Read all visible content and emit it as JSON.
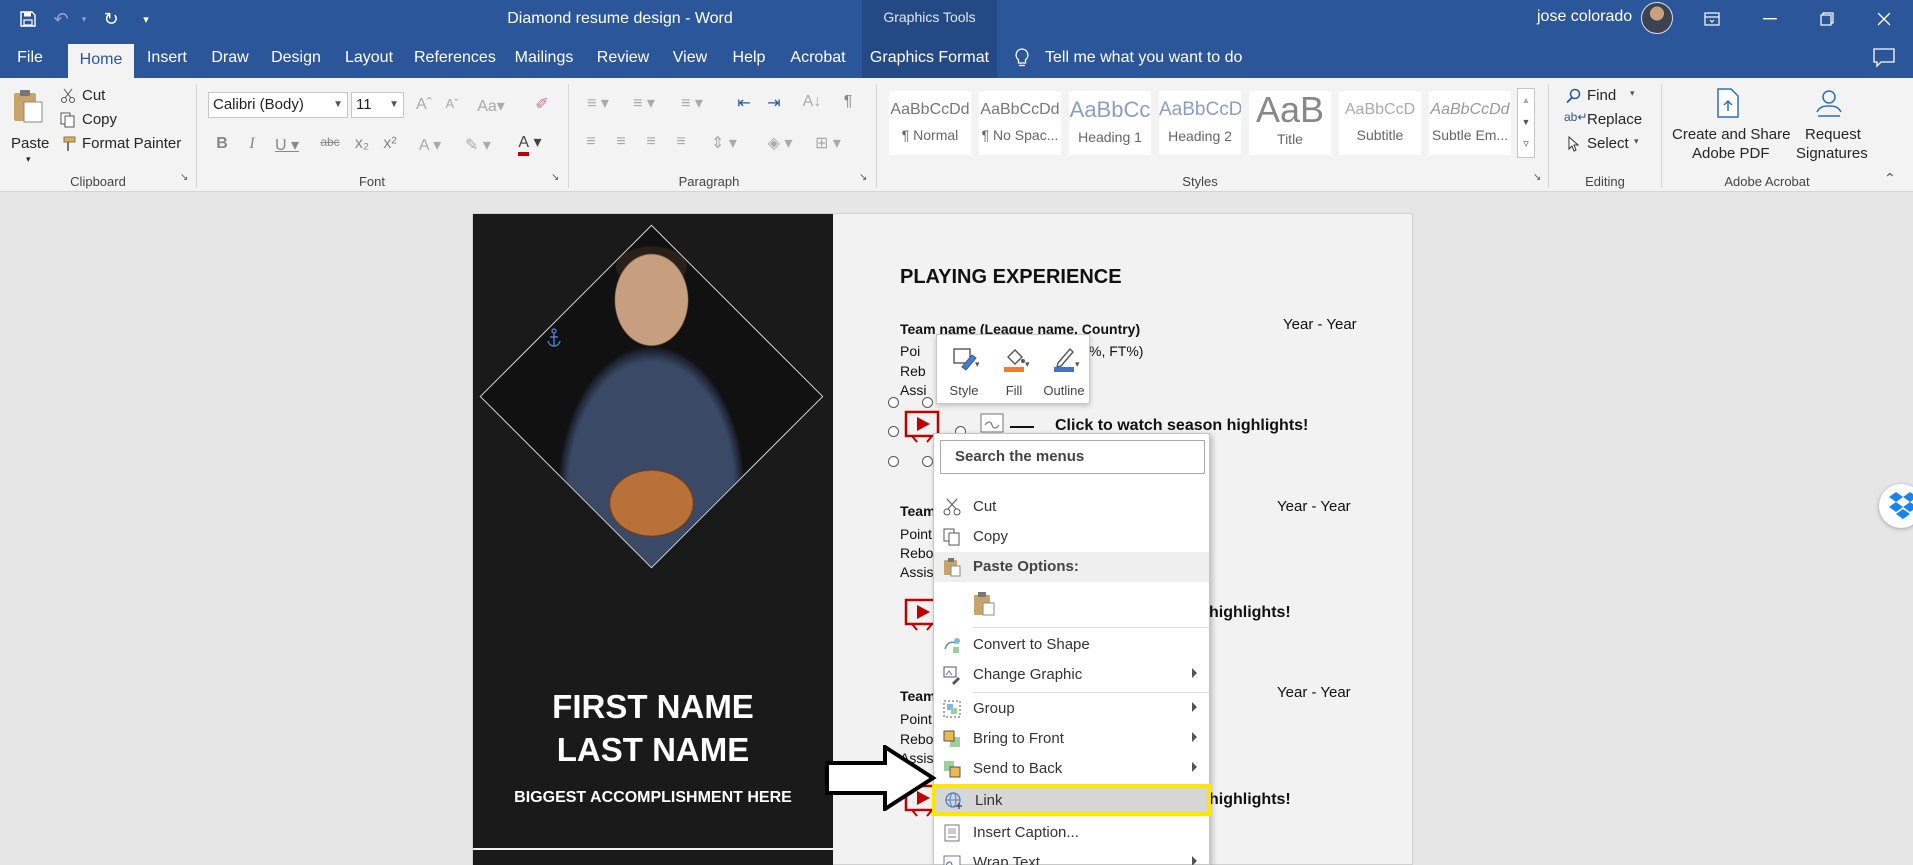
{
  "window": {
    "title": "Diamond resume design  -  Word",
    "contextual_group": "Graphics Tools",
    "user": "jose colorado"
  },
  "tabs": {
    "file": "File",
    "home": "Home",
    "insert": "Insert",
    "draw": "Draw",
    "design": "Design",
    "layout": "Layout",
    "references": "References",
    "mailings": "Mailings",
    "review": "Review",
    "view": "View",
    "help": "Help",
    "acrobat": "Acrobat",
    "graphics_format": "Graphics Format",
    "tell_me": "Tell me what you want to do"
  },
  "ribbon": {
    "clipboard": {
      "paste": "Paste",
      "cut": "Cut",
      "copy": "Copy",
      "format_painter": "Format Painter",
      "label": "Clipboard"
    },
    "font": {
      "name": "Calibri (Body)",
      "size": "11",
      "label": "Font"
    },
    "paragraph": {
      "label": "Paragraph"
    },
    "styles": {
      "label": "Styles",
      "items": [
        {
          "sample": "AaBbCcDd",
          "name": "¶ Normal"
        },
        {
          "sample": "AaBbCcDd",
          "name": "¶ No Spac..."
        },
        {
          "sample": "AaBbCc",
          "name": "Heading 1"
        },
        {
          "sample": "AaBbCcD",
          "name": "Heading 2"
        },
        {
          "sample": "AaB",
          "name": "Title"
        },
        {
          "sample": "AaBbCcD",
          "name": "Subtitle"
        },
        {
          "sample": "AaBbCcDd",
          "name": "Subtle Em..."
        }
      ]
    },
    "editing": {
      "find": "Find",
      "replace": "Replace",
      "select": "Select",
      "label": "Editing"
    },
    "acrobat": {
      "create_share": "Create and Share",
      "adobe_pdf": "Adobe PDF",
      "request": "Request",
      "signatures": "Signatures",
      "label": "Adobe Acrobat"
    }
  },
  "document": {
    "first_name": "FIRST NAME",
    "last_name": "LAST NAME",
    "accomplishment": "BIGGEST ACCOMPLISHMENT HERE",
    "section_title": "PLAYING EXPERIENCE",
    "team1": "Team name (League name, Country)",
    "team_partial": "Team",
    "year_range": "Year - Year",
    "stat_points_1": "Poi",
    "stat_points_1_tail": "%, FT%)",
    "stat_rebounds_1": "Reb",
    "stat_assists_1": "Assi",
    "stat_points": "Point",
    "stat_rebounds": "Rebo",
    "stat_assists": "Assis",
    "highlights_full": "Click to watch season highlights!",
    "highlights_partial": "highlights!"
  },
  "mini_toolbar": {
    "style": "Style",
    "fill": "Fill",
    "outline": "Outline"
  },
  "context_menu": {
    "search": "Search the menus",
    "cut": "Cut",
    "copy": "Copy",
    "paste_options": "Paste Options:",
    "convert_to_shape": "Convert to Shape",
    "change_graphic": "Change Graphic",
    "group": "Group",
    "bring_to_front": "Bring to Front",
    "send_to_back": "Send to Back",
    "link": "Link",
    "insert_caption": "Insert Caption...",
    "wrap_text": "Wrap Text"
  },
  "colors": {
    "word_blue": "#2b579a",
    "highlight_yellow": "#ffe600",
    "play_red": "#c00000",
    "fill_orange": "#ed7d31",
    "outline_blue": "#4472c4"
  }
}
